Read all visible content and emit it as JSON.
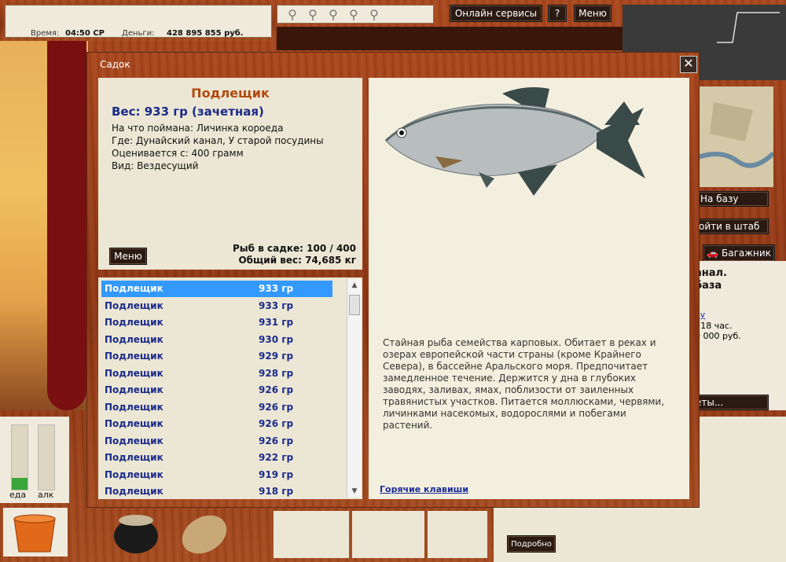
{
  "status": {
    "time_label": "Время:",
    "time_value": "04:50 СР",
    "money_label": "Деньги:",
    "money_value": "428 895 855 руб."
  },
  "top_buttons": {
    "online": "Онлайн сервисы",
    "help": "?",
    "menu": "Меню"
  },
  "bars": {
    "food_label": "еда",
    "alc_label": "алк",
    "food_level": 0.18,
    "alc_level": 0.0
  },
  "side": {
    "to_base": "На базу",
    "hq": "ойти в штаб",
    "trunk": "Багажник",
    "info_line1": "анал.",
    "info_line2": "база",
    "info_link": "ку",
    "info_line3": ": 18 час.",
    "info_line4": "0 000 руб.",
    "info_line5": "1",
    "tickets": "еты..."
  },
  "bottom": {
    "details": "Подробно"
  },
  "dialog": {
    "title": "Садок",
    "close": "✕",
    "fish_name": "Подлещик",
    "fish_weight": "Вес: 933 гр (зачетная)",
    "bait": "На что поймана: Личинка короеда",
    "where": "Где: Дунайский канал, У старой посудины",
    "rated": "Оценивается с: 400 грамм",
    "kind": "Вид: Вездесущий",
    "menu": "Меню",
    "count": "Рыб в садке: 100 / 400",
    "total": "Общий вес: 74,685 кг",
    "description": "Стайная рыба семейства карповых. Обитает в реках и озерах европейской части страны (кроме Крайнего Севера), в бассейне Аральского моря. Предпочитает замедленное течение. Держится у дна в глубоких заводях, заливах, ямах, поблизости от заиленных травянистых участков. Питается моллюсками, червями, личинками насекомых, водорослями и побегами растений.",
    "hotkeys": "Горячие клавиши"
  },
  "fish_list": [
    {
      "name": "Подлещик",
      "weight": "933 гр"
    },
    {
      "name": "Подлещик",
      "weight": "933 гр"
    },
    {
      "name": "Подлещик",
      "weight": "931 гр"
    },
    {
      "name": "Подлещик",
      "weight": "930 гр"
    },
    {
      "name": "Подлещик",
      "weight": "929 гр"
    },
    {
      "name": "Подлещик",
      "weight": "928 гр"
    },
    {
      "name": "Подлещик",
      "weight": "926 гр"
    },
    {
      "name": "Подлещик",
      "weight": "926 гр"
    },
    {
      "name": "Подлещик",
      "weight": "926 гр"
    },
    {
      "name": "Подлещик",
      "weight": "926 гр"
    },
    {
      "name": "Подлещик",
      "weight": "922 гр"
    },
    {
      "name": "Подлещик",
      "weight": "919 гр"
    },
    {
      "name": "Подлещик",
      "weight": "918 гр"
    }
  ],
  "icons": {
    "tool": "tackle-icon",
    "trunk": "car-icon",
    "bucket": "bucket-icon",
    "pot": "pot-icon",
    "sack": "sack-icon",
    "fish": "bream-fish-image"
  }
}
